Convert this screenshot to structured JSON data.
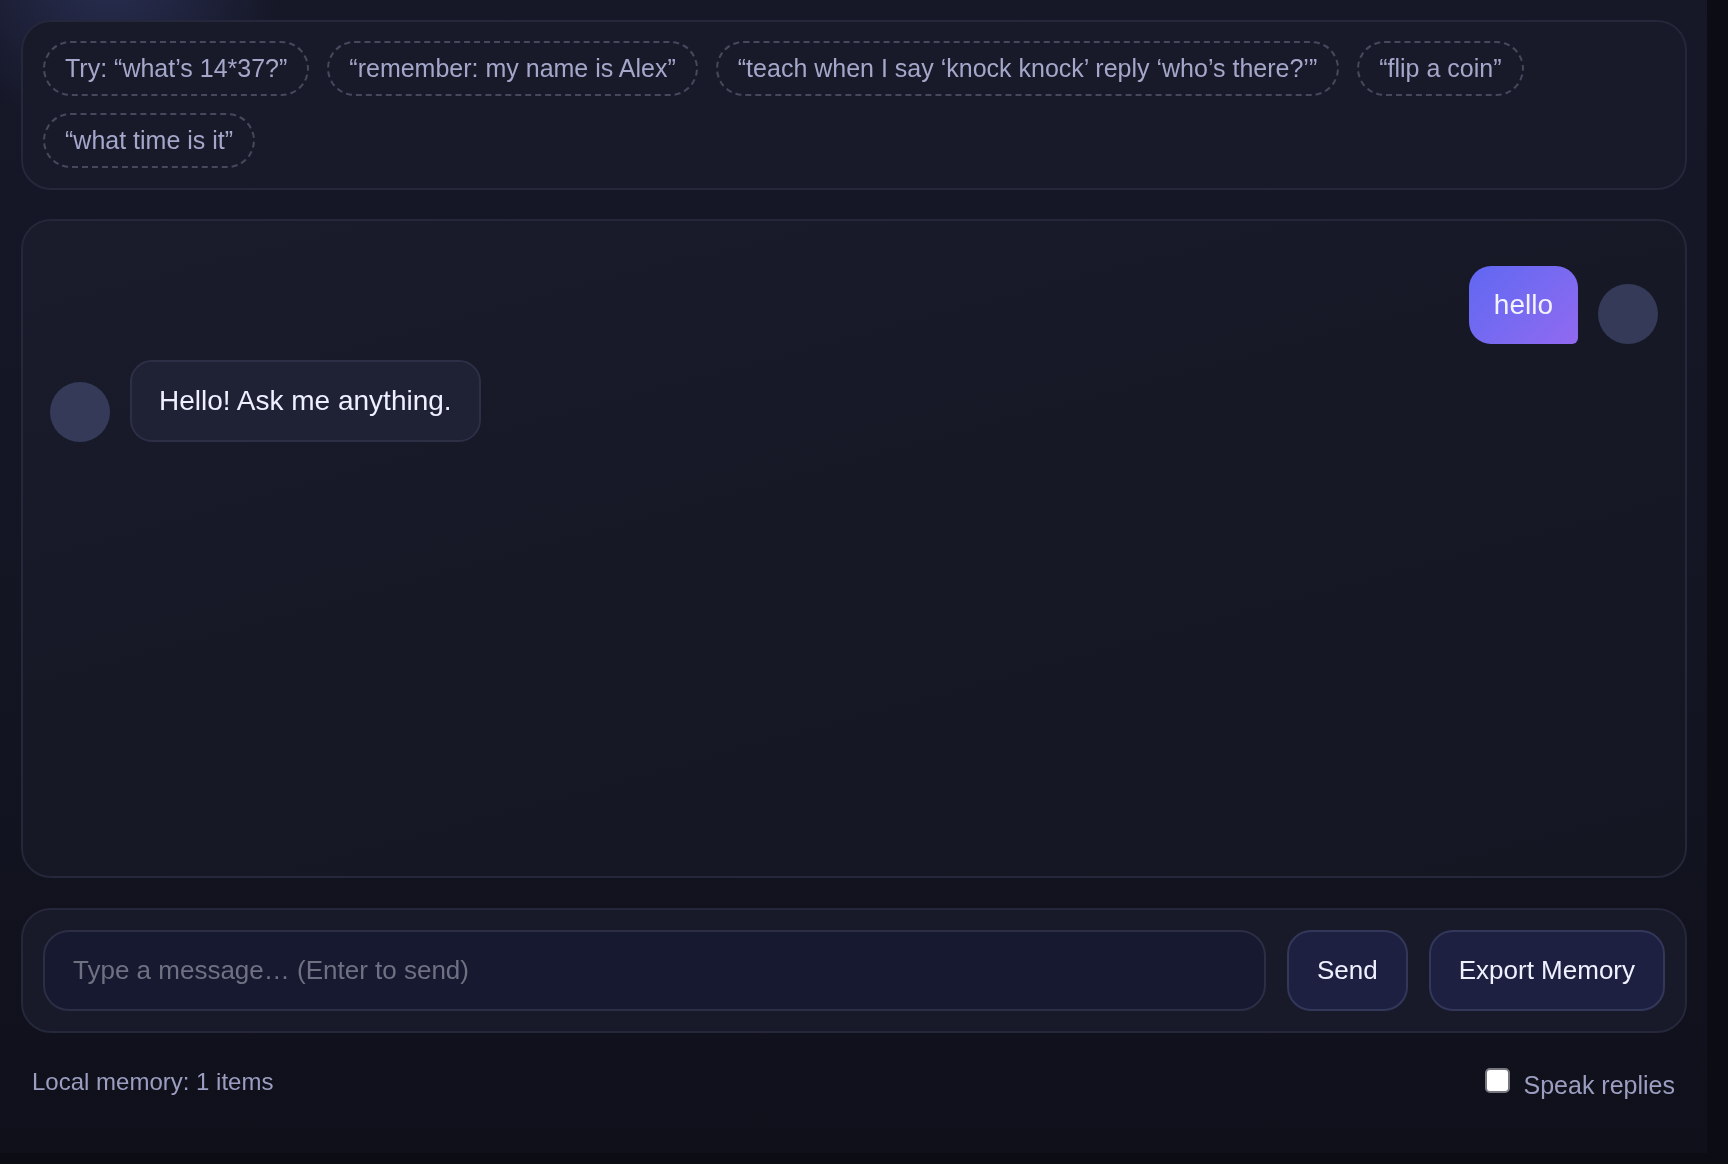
{
  "suggestions": [
    "Try: “what’s 14*37?”",
    "“remember: my name is Alex”",
    "“teach when I say ‘knock knock’ reply ‘who’s there?’”",
    "“flip a coin”",
    "“what time is it”"
  ],
  "messages": [
    {
      "kind": "user",
      "text": "hello"
    },
    {
      "kind": "bot",
      "text": "Hello! Ask me anything."
    }
  ],
  "composer": {
    "placeholder": "Type a message… (Enter to send)",
    "buttons": [
      "Send",
      "Export Memory"
    ]
  },
  "footer": {
    "memory_status": "Local memory: 1 items",
    "speak_replies": {
      "label": "Speak replies",
      "checked": false
    }
  }
}
